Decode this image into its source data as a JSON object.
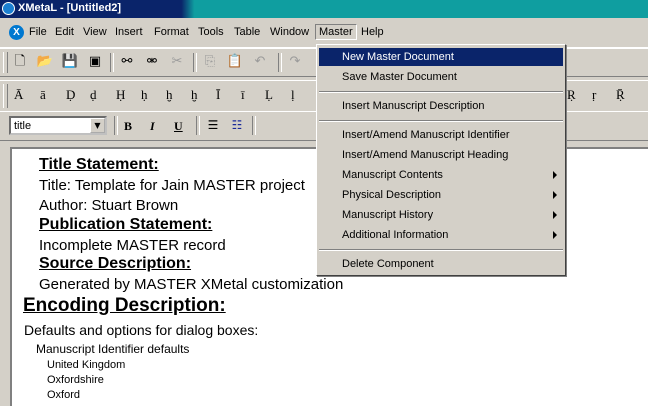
{
  "window": {
    "title": "XMetaL - [Untitled2]"
  },
  "menubar": {
    "items": [
      {
        "key": "file",
        "label": "File"
      },
      {
        "key": "edit",
        "label": "Edit"
      },
      {
        "key": "view",
        "label": "View"
      },
      {
        "key": "insert",
        "label": "Insert"
      },
      {
        "key": "format",
        "label": "Format"
      },
      {
        "key": "tools",
        "label": "Tools"
      },
      {
        "key": "table",
        "label": "Table"
      },
      {
        "key": "window",
        "label": "Window"
      },
      {
        "key": "master",
        "label": "Master",
        "active": true
      },
      {
        "key": "help",
        "label": "Help"
      }
    ]
  },
  "toolbar_characters": [
    "Ā",
    "ā",
    "Ḍ",
    "ḍ",
    "Ḥ",
    "ḥ",
    "ḫ",
    "ḫ",
    "Ī",
    "ī",
    "Ḷ",
    "ḷ"
  ],
  "toolbar_characters_right": [
    "Ṛ",
    "ṛ",
    "Ṝ"
  ],
  "format_toolbar": {
    "style_value": "title",
    "bold": "B",
    "italic": "I",
    "underline": "U"
  },
  "master_menu": {
    "items": [
      {
        "label": "New Master Document",
        "selected": true,
        "submenu": false
      },
      {
        "label": "Save Master Document",
        "submenu": false
      },
      {
        "sep": true
      },
      {
        "label": "Insert Manuscript Description",
        "submenu": false
      },
      {
        "sep": true
      },
      {
        "label": "Insert/Amend Manuscript Identifier",
        "submenu": false
      },
      {
        "label": "Insert/Amend Manuscript Heading",
        "submenu": false
      },
      {
        "label": "Manuscript Contents",
        "submenu": true
      },
      {
        "label": "Physical Description",
        "submenu": true
      },
      {
        "label": "Manuscript History",
        "submenu": true
      },
      {
        "label": "Additional Information",
        "submenu": true
      },
      {
        "sep": true
      },
      {
        "label": "Delete Component",
        "submenu": false
      }
    ]
  },
  "document": {
    "title_statement_heading": "Title Statement:",
    "title_line": "Title: Template for Jain MASTER project",
    "author_line": "Author: Stuart Brown",
    "publication_heading": "Publication Statement:",
    "publication_text": "Incomplete MASTER record",
    "source_heading": "Source Description:",
    "source_text": "Generated by MASTER XMetal customization",
    "encoding_heading": "Encoding Description:",
    "defaults_text": "Defaults and options for dialog boxes:",
    "ms_identifier_defaults": "Manuscript Identifier defaults",
    "country": "United Kingdom",
    "county": "Oxfordshire",
    "city": "Oxford"
  }
}
